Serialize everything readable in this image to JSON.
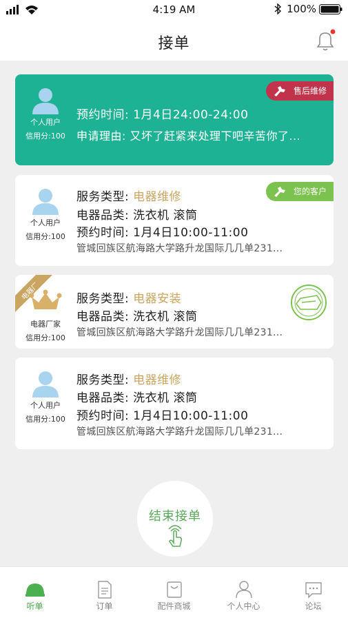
{
  "status_bar": {
    "time": "4:19 AM",
    "battery": "100%"
  },
  "header": {
    "title": "接单"
  },
  "cards": [
    {
      "user_type": "个人用户",
      "credit": "信用分:100",
      "tag": "售后维修",
      "lines": [
        {
          "label": "预约时间:",
          "value": "1月4日24:00-24:00"
        },
        {
          "label": "申请理由:",
          "value": "又坏了赶紧来处理下吧辛苦你了..."
        }
      ]
    },
    {
      "user_type": "个人用户",
      "credit": "信用分:100",
      "tag": "您的客户",
      "lines": [
        {
          "label": "服务类型:",
          "value": "电器维修"
        },
        {
          "label": "电器品类:",
          "value": "洗衣机 滚筒"
        },
        {
          "label": "预约时间:",
          "value": "1月4日10:00-11:00"
        }
      ],
      "address": "管城回族区航海路大学路升龙国际几几单231..."
    },
    {
      "ribbon": "电器厂",
      "user_type": "电器厂家",
      "credit": "信用分:100",
      "lines": [
        {
          "label": "服务类型:",
          "value": "电器安装"
        },
        {
          "label": "电器品类:",
          "value": "洗衣机 滚筒"
        }
      ],
      "address": "管城回族区航海路大学路升龙国际几几单231..."
    },
    {
      "user_type": "个人用户",
      "credit": "信用分:100",
      "lines": [
        {
          "label": "服务类型:",
          "value": "电器维修"
        },
        {
          "label": "电器品类:",
          "value": "洗衣机 滚筒"
        },
        {
          "label": "预约时间:",
          "value": "1月4日10:00-11:00"
        }
      ],
      "address": "管城回族区航海路大学路升龙国际几几单231..."
    }
  ],
  "end_button": {
    "label": "结束接单"
  },
  "bottom_nav": [
    {
      "label": "听单",
      "icon": "helmet-icon",
      "active": true
    },
    {
      "label": "订单",
      "icon": "document-icon",
      "active": false
    },
    {
      "label": "配件商城",
      "icon": "shopping-bag-icon",
      "active": false
    },
    {
      "label": "个人中心",
      "icon": "person-icon",
      "active": false
    },
    {
      "label": "论坛",
      "icon": "chat-icon",
      "active": false
    }
  ],
  "colors": {
    "featured_card": "#1eb294",
    "red_tag": "#c0334a",
    "green_tag": "#7bc24f",
    "service_value": "#c9a561",
    "active_nav": "#4caf50"
  }
}
